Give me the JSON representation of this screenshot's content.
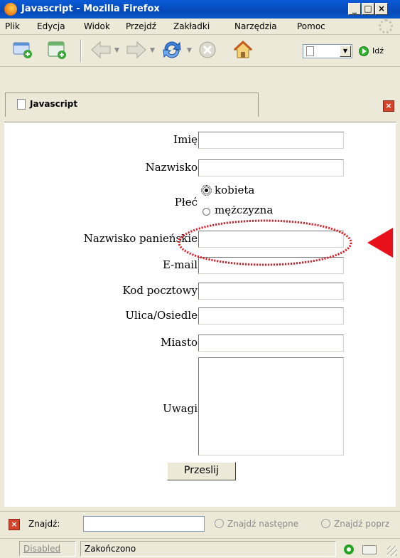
{
  "window": {
    "title": "Javascript - Mozilla Firefox"
  },
  "menu": {
    "items": [
      "Plik",
      "Edycja",
      "Widok",
      "Przejdź",
      "Zakładki",
      "Narzędzia",
      "Pomoc"
    ]
  },
  "toolbar": {
    "go_label": "Idź"
  },
  "tab": {
    "title": "Javascript"
  },
  "form": {
    "fields": {
      "first_name": {
        "label": "Imię",
        "value": ""
      },
      "last_name": {
        "label": "Nazwisko",
        "value": ""
      },
      "gender": {
        "label": "Płeć",
        "options": [
          "kobieta",
          "mężczyzna"
        ],
        "selected": "kobieta"
      },
      "maiden_name": {
        "label": "Nazwisko panieńskie",
        "value": ""
      },
      "email": {
        "label": "E-mail",
        "value": ""
      },
      "postal_code": {
        "label": "Kod pocztowy",
        "value": ""
      },
      "street": {
        "label": "Ulica/Osiedle",
        "value": ""
      },
      "city": {
        "label": "Miasto",
        "value": ""
      },
      "notes": {
        "label": "Uwagi",
        "value": ""
      }
    },
    "submit_label": "Przeslij"
  },
  "findbar": {
    "label": "Znajdź:",
    "value": "",
    "next_label": "Znajdź następne",
    "prev_label": "Znajdź poprz"
  },
  "statusbar": {
    "left": "Disabled",
    "status": "Zakończono"
  },
  "colors": {
    "annotation": "#e8101a",
    "titlebar": "#0548b8"
  }
}
